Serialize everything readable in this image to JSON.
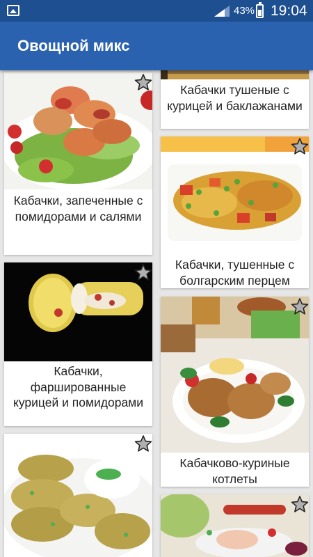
{
  "status_bar": {
    "icons": [
      "gallery-icon",
      "signal-icon",
      "battery-icon"
    ],
    "battery_percent": "43%",
    "time": "19:04"
  },
  "app_bar": {
    "title": "Овощной микс"
  },
  "recipes": [
    {
      "title": "Кабачки, запеченные с помидорами и салями",
      "favorite": false
    },
    {
      "title": "Кабачки тушеные с курицей и баклажанами",
      "favorite": false
    },
    {
      "title": "Кабачки, тушенные с болгарским перцем",
      "favorite": false
    },
    {
      "title": "Кабачки, фаршированные курицей и помидорами",
      "favorite": false
    },
    {
      "title": "Кабачково-куриные котлеты",
      "favorite": false
    }
  ],
  "colors": {
    "status_bar": "#1e4f91",
    "app_bar": "#2a62b0",
    "background": "#e6e6e6",
    "star_fill": "#b0b0b0"
  }
}
